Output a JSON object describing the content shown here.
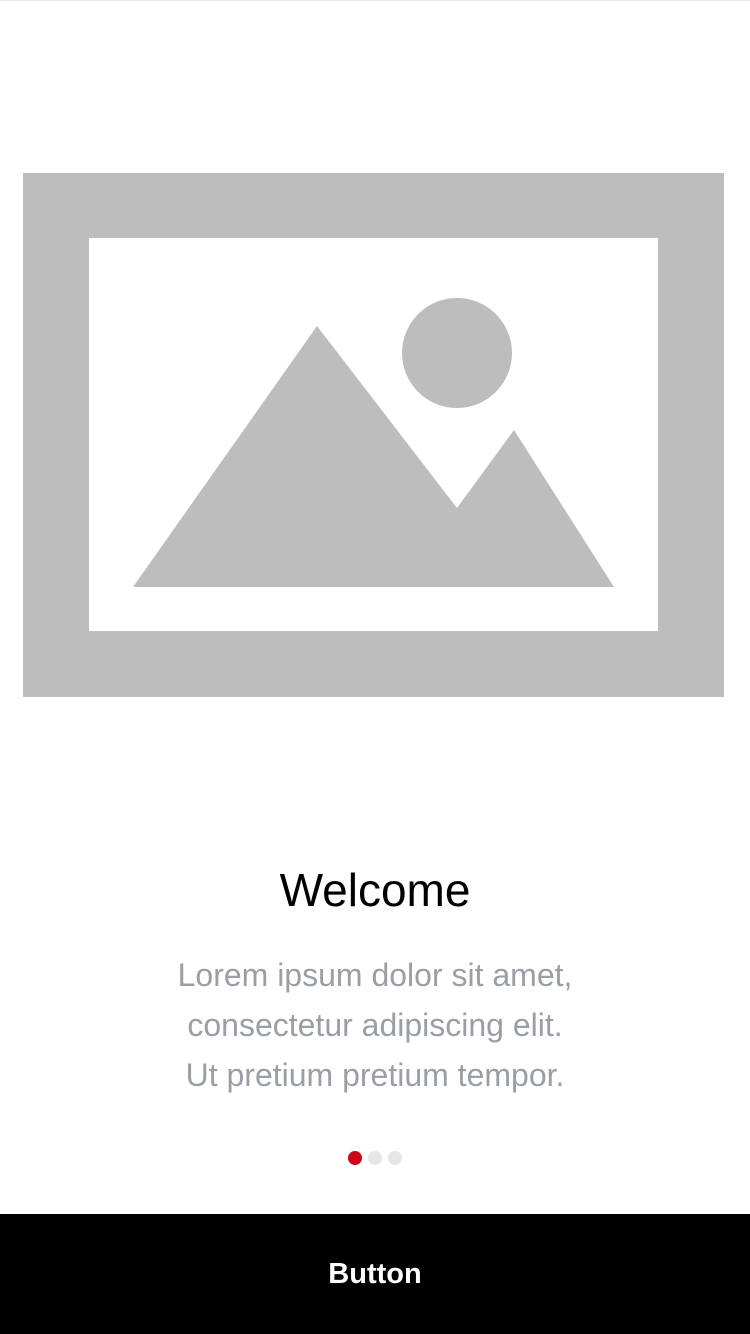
{
  "onboarding": {
    "title": "Welcome",
    "body_lines": [
      "Lorem ipsum dolor sit amet,",
      "consectetur adipiscing elit.",
      "Ut pretium pretium tempor."
    ],
    "page_indicator": {
      "count": 3,
      "active_index": 0
    },
    "image_icon": "image-placeholder-icon"
  },
  "action": {
    "button_label": "Button"
  },
  "colors": {
    "accent": "#d0021b",
    "inactive_dot": "#e6e6e6",
    "placeholder_gray": "#bdbdbd",
    "button_bg": "#000000",
    "button_text": "#ffffff",
    "body_text": "#9a9ea5"
  }
}
